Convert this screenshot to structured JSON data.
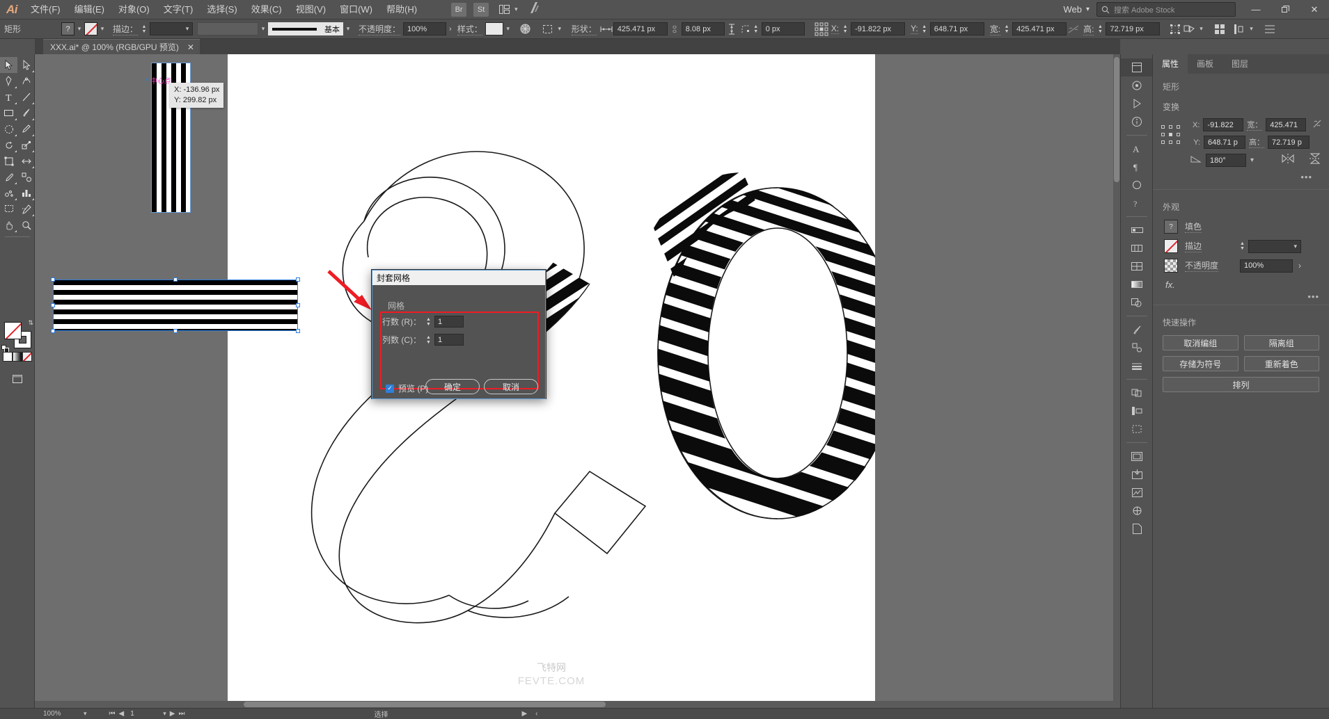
{
  "app": {
    "logo": "Ai",
    "menus": [
      {
        "label": "文件(F)"
      },
      {
        "label": "编辑(E)"
      },
      {
        "label": "对象(O)"
      },
      {
        "label": "文字(T)"
      },
      {
        "label": "选择(S)"
      },
      {
        "label": "效果(C)"
      },
      {
        "label": "视图(V)"
      },
      {
        "label": "窗口(W)"
      },
      {
        "label": "帮助(H)"
      }
    ],
    "quick_apps": [
      {
        "label": "Br"
      },
      {
        "label": "St"
      }
    ],
    "workspace": "Web",
    "stock_search_placeholder": "搜索 Adobe Stock",
    "window_controls": {
      "minimize": "—",
      "restore": "❐",
      "close": "✕"
    }
  },
  "control_bar": {
    "object_type": "矩形",
    "fill_swatch": "?",
    "stroke_swatch": "none-swatch",
    "stroke_label": "描边：",
    "stroke_weight": "",
    "stroke_profile": "基本",
    "opacity_label": "不透明度：",
    "opacity_value": "100%",
    "style_label": "样式：",
    "shape_label": "形状：",
    "width_value": "425.471 px",
    "height_value": "8.08 px",
    "corner_value": "0 px",
    "x_label": "X:",
    "x_value": "-91.822 px",
    "y_label": "Y:",
    "y_value": "648.71 px",
    "w_label": "宽:",
    "w_value": "425.471 px",
    "h_label": "高:",
    "h_value": "72.719 px"
  },
  "document": {
    "tab_title": "XXX.ai* @ 100% (RGB/GPU 预览)",
    "close_glyph": "✕"
  },
  "canvas": {
    "tooltip": {
      "x": "X: -136.96 px",
      "y": "Y: 299.82 px"
    },
    "anchor_label": "中心点",
    "watermark_cn": "飞特网",
    "watermark_en": "FEVTE.COM"
  },
  "dialog": {
    "title": "封套网格",
    "section": "网格",
    "rows_label": "行数 (R)：",
    "rows_value": "1",
    "cols_label": "列数 (C)：",
    "cols_value": "1",
    "preview_label": "预览 (P)",
    "preview_checked": true,
    "ok": "确定",
    "cancel": "取消",
    "highlight_color": "#ee1c24"
  },
  "properties": {
    "tabs": [
      {
        "label": "属性",
        "active": true
      },
      {
        "label": "画板",
        "active": false
      },
      {
        "label": "图层",
        "active": false
      }
    ],
    "object_type": "矩形",
    "transform_heading": "变换",
    "transform": {
      "x_label": "X:",
      "x_value": "-91.822",
      "y_label": "Y:",
      "y_value": "648.71 p",
      "w_label": "宽：",
      "w_value": "425.471",
      "h_label": "高：",
      "h_value": "72.719 p",
      "angle_value": "180°"
    },
    "appearance_heading": "外观",
    "appearance": {
      "fill_label": "填色",
      "fill_swatch": "?",
      "stroke_label": "描边",
      "stroke_swatch": "none-swatch",
      "stroke_weight": "",
      "opacity_label": "不透明度",
      "opacity_value": "100%",
      "fx_label": "fx."
    },
    "quick_actions_heading": "快速操作",
    "quick_actions": [
      {
        "label": "取消编组"
      },
      {
        "label": "隔离组"
      },
      {
        "label": "存储为符号"
      },
      {
        "label": "重新着色"
      },
      {
        "label": "排列"
      }
    ],
    "more_dots": "•••"
  },
  "status_bar": {
    "zoom": "100%",
    "page": "1",
    "tool": "选择"
  },
  "icons": {
    "search": "search-icon",
    "chevron_down": "⌄",
    "stepper_up": "▲",
    "stepper_down": "▼",
    "arrow_right": "›",
    "check": "✓",
    "first_page": "|◀",
    "prev_page": "◀",
    "next_page": "▶",
    "last_page": "▶|"
  }
}
